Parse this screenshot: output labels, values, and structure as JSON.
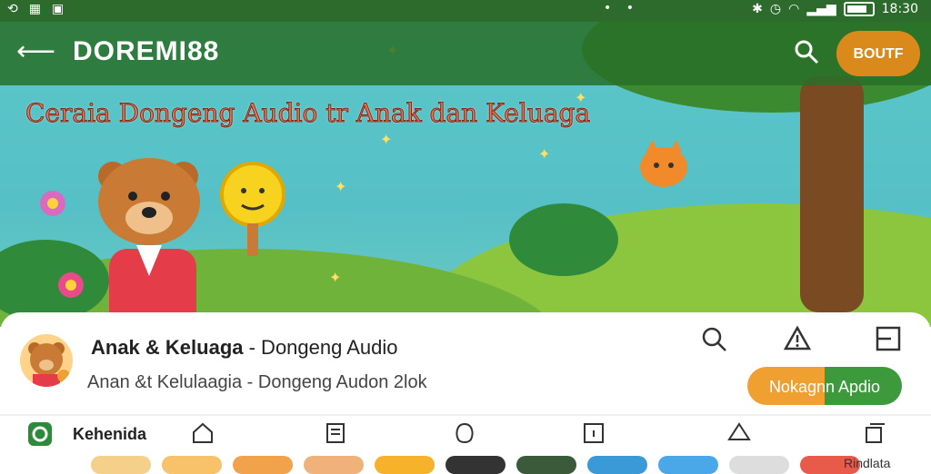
{
  "status_bar": {
    "time": "18:30",
    "left_icons": [
      "sync-icon",
      "grid-icon",
      "screen-icon"
    ],
    "right_icons": [
      "bluetooth-icon",
      "alarm-icon",
      "wifi-icon",
      "signal-icon",
      "battery-icon"
    ],
    "dots": "• •"
  },
  "app_bar": {
    "title": "DOREMI88",
    "action_button": "BOUTF"
  },
  "hero": {
    "banner": "Ceraia Dongeng Audio tr Anak dan Keluaga"
  },
  "channel": {
    "title_bold": "Anak & Keluaga",
    "title_rest": " - Dongeng Audio",
    "subtitle": "Anan &t Kelulaagia - Dongeng Audon 2lok",
    "listen_button": "Nokagnn Apdio",
    "icons": [
      "search-icon",
      "alert-icon",
      "list-icon"
    ]
  },
  "bottom_nav": {
    "label": "Kehenida",
    "right_label": "Rindlata",
    "icons": [
      "home-icon",
      "notes-icon",
      "shell-icon",
      "info-icon",
      "share-icon",
      "copy-icon"
    ]
  },
  "colors": {
    "status_bar": "#2c6b2c",
    "accent_orange": "#d98a1a",
    "accent_green": "#3c9a3c"
  }
}
